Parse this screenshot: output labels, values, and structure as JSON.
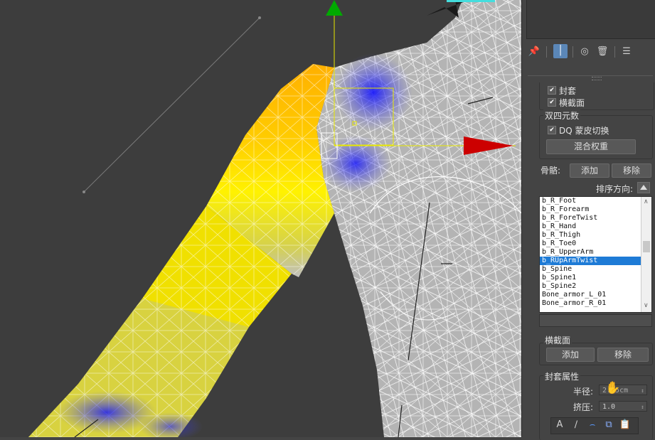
{
  "envelope_section": {
    "envelope_label": "封套",
    "cross_section_label": "横截面"
  },
  "dual_quaternion": {
    "title": "双四元数",
    "dq_toggle_label": "DQ 蒙皮切换",
    "blend_weights_label": "混合权重"
  },
  "bones": {
    "label": "骨骼:",
    "add_label": "添加",
    "remove_label": "移除",
    "sort_label": "排序方向:",
    "items": [
      "b_R_Foot",
      "b_R_Forearm",
      "b_R_ForeTwist",
      "b_R_Hand",
      "b_R_Thigh",
      "b_R_Toe0",
      "b_R_UpperArm",
      "b_RUpArmTwist",
      "b_Spine",
      "b_Spine1",
      "b_Spine2",
      "Bone_armor_L_01",
      "Bone_armor_R_01"
    ],
    "selected": "b_RUpArmTwist"
  },
  "cross_section": {
    "title": "横截面",
    "add_label": "添加",
    "remove_label": "移除"
  },
  "envelope_props": {
    "title": "封套属性",
    "radius_label": "半径:",
    "radius_value": "2.25cm",
    "squash_label": "挤压:",
    "squash_value": "1.0"
  },
  "colors": {
    "accent": "#1e7bd6",
    "viewport_bg": "#3d3d3d",
    "panel_bg": "#444444"
  }
}
